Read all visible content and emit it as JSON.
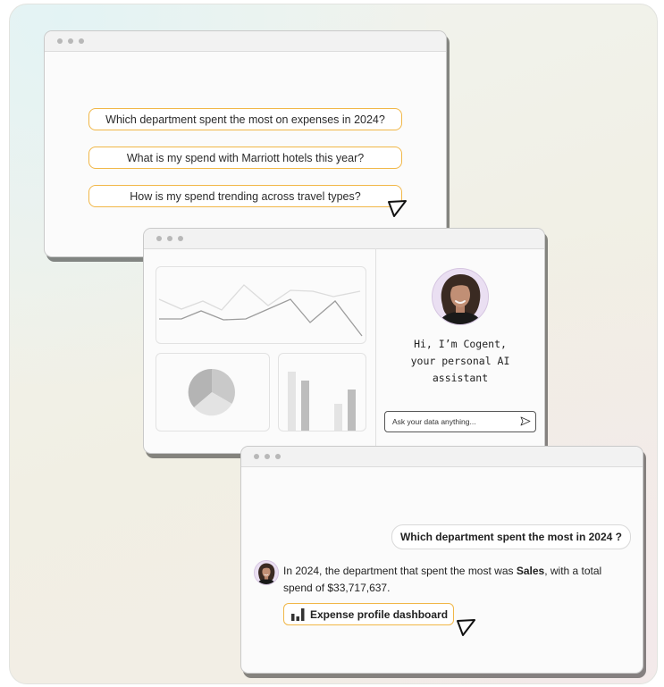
{
  "questions_window": {
    "suggestions": [
      "Which department spent the most on expenses in 2024?",
      "What is my spend with Marriott hotels this year?",
      "How is my spend trending across travel types?"
    ]
  },
  "assistant_window": {
    "greeting": "Hi, I’m Cogent,\nyour personal AI\nassistant",
    "input_placeholder": "Ask your data anything...",
    "chart_colors": [
      "#c7c7c7",
      "#e3e3e3",
      "#b7b7b7"
    ]
  },
  "chat_window": {
    "user_question": "Which department spent the most in 2024 ?",
    "answer_prefix": "In 2024, the department that spent the most was ",
    "answer_highlight": "Sales",
    "answer_suffix": ", with a total spend of $33,717,637.",
    "link_label": "Expense profile dashboard",
    "link_icon": "bar-chart-icon"
  },
  "colors": {
    "accent": "#f1b748",
    "window_bg": "#fbfbfb"
  }
}
